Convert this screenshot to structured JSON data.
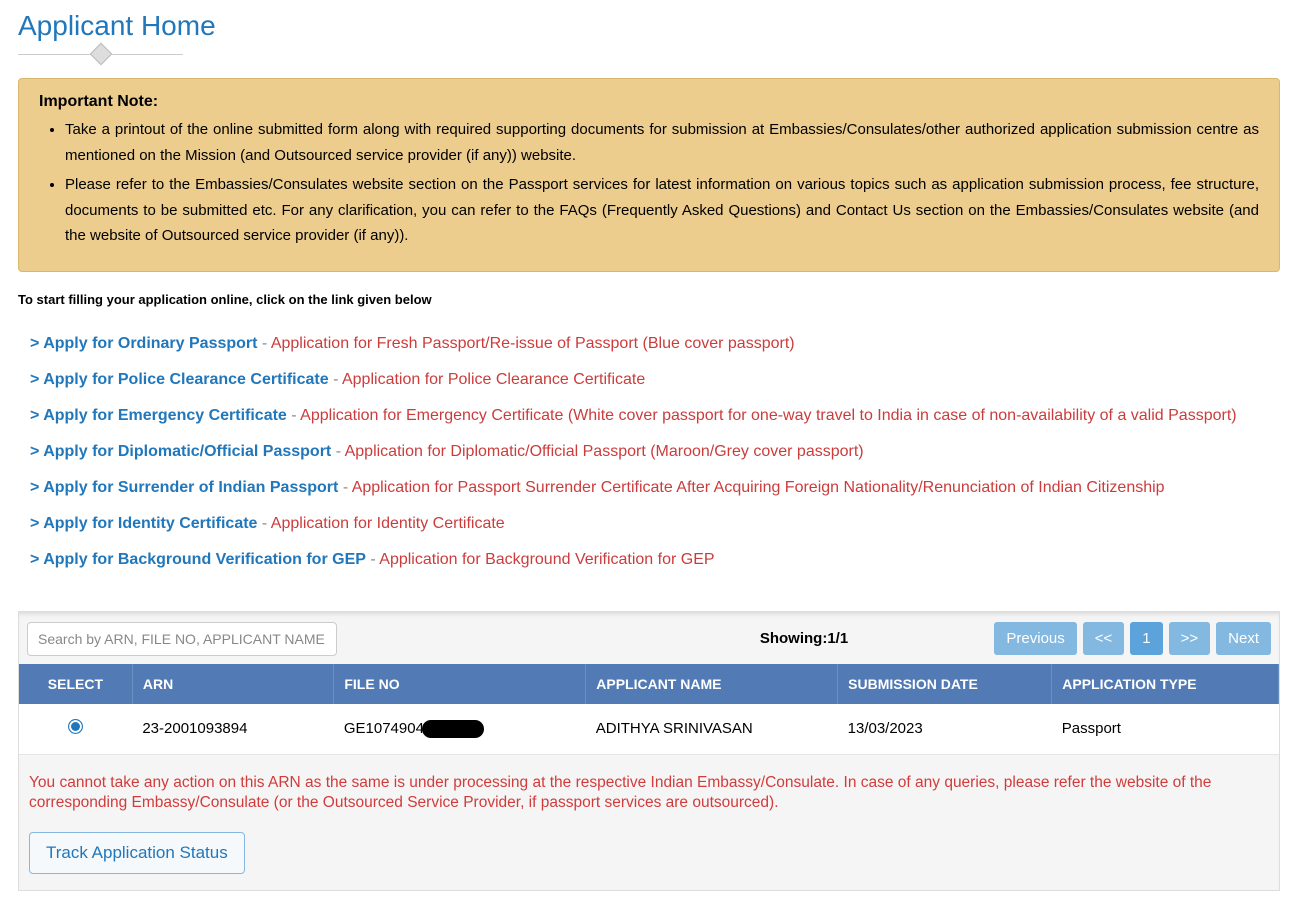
{
  "pageTitle": "Applicant Home",
  "noteHeading": "Important Note:",
  "noteBullets": [
    "Take a printout of the online submitted form along with required supporting documents for submission at Embassies/Consulates/other authorized application submission centre as mentioned on the Mission (and Outsourced service provider (if any)) website.",
    "Please refer to the Embassies/Consulates website section on the Passport services for latest information on various topics such as application submission process, fee structure, documents to be submitted etc. For any clarification, you can refer to the FAQs (Frequently Asked Questions) and Contact Us section on the Embassies/Consulates website (and the website of Outsourced service provider (if any))."
  ],
  "instruction": "To start filling your application online, click on the link given below",
  "applyLinks": [
    {
      "label": "Apply for Ordinary Passport",
      "desc": "Application for Fresh Passport/Re-issue of Passport (Blue cover passport)"
    },
    {
      "label": "Apply for Police Clearance Certificate",
      "desc": "Application for Police Clearance Certificate"
    },
    {
      "label": "Apply for Emergency Certificate",
      "desc": "Application for Emergency Certificate (White cover passport for one-way travel to India in case of non-availability of a valid Passport)"
    },
    {
      "label": "Apply for Diplomatic/Official Passport",
      "desc": "Application for Diplomatic/Official Passport (Maroon/Grey cover passport)"
    },
    {
      "label": "Apply for Surrender of Indian Passport",
      "desc": "Application for Passport Surrender Certificate After Acquiring Foreign Nationality/Renunciation of Indian Citizenship"
    },
    {
      "label": "Apply for Identity Certificate",
      "desc": "Application for Identity Certificate"
    },
    {
      "label": "Apply for Background Verification for GEP",
      "desc": "Application for Background Verification for GEP"
    }
  ],
  "search": {
    "placeholder": "Search by ARN, FILE NO, APPLICANT NAME"
  },
  "showing": "Showing:1/1",
  "pager": {
    "previous": "Previous",
    "first": "<<",
    "page": "1",
    "last": ">>",
    "next": "Next"
  },
  "table": {
    "headers": {
      "select": "SELECT",
      "arn": "ARN",
      "fileNo": "FILE NO",
      "applicantName": "APPLICANT NAME",
      "submissionDate": "SUBMISSION DATE",
      "applicationType": "APPLICATION TYPE"
    },
    "row": {
      "arn": "23-2001093894",
      "fileNo": "GE1074904",
      "applicantName": "ADITHYA SRINIVASAN",
      "submissionDate": "13/03/2023",
      "applicationType": "Passport"
    }
  },
  "warning": "You cannot take any action on this ARN as the same is under processing at the respective Indian Embassy/Consulate. In case of any queries, please refer the website of the corresponding Embassy/Consulate (or the Outsourced Service Provider, if passport services are outsourced).",
  "trackButton": "Track Application Status"
}
